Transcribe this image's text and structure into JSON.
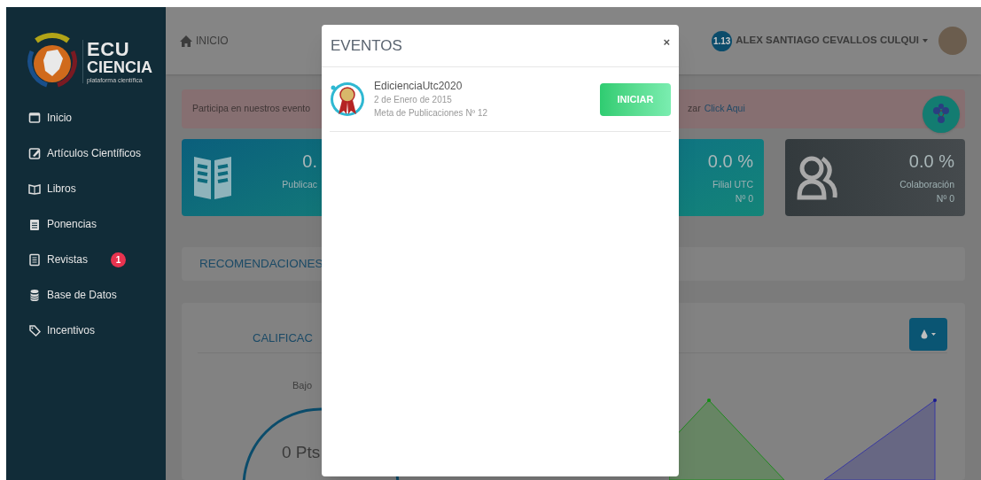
{
  "sidebar": {
    "logo": {
      "line_1": "ECU",
      "line_2": "CIENCIA",
      "tagline": "plataforma científica"
    },
    "items": [
      {
        "label": "Inicio",
        "kind": "square"
      },
      {
        "label": "Artículos Científicos",
        "kind": "edit"
      },
      {
        "label": "Libros",
        "kind": "book"
      },
      {
        "label": "Ponencias",
        "kind": "notepad"
      },
      {
        "label": "Revistas",
        "kind": "document",
        "badge": "1"
      },
      {
        "label": "Base de Datos",
        "kind": "database"
      },
      {
        "label": "Incentivos",
        "kind": "tag"
      }
    ]
  },
  "topbar": {
    "breadcrumb": "INICIO",
    "level_badge": "1.13",
    "user_name": "ALEX SANTIAGO CEVALLOS CULQUI"
  },
  "alert": {
    "text_start": "Participa en nuestros evento",
    "text_end": "zar",
    "link": "Click Aqui"
  },
  "stat_cards": [
    {
      "kind": "book",
      "value": "0.",
      "label": "Publicac"
    },
    {
      "kind": "hidden"
    },
    {
      "kind": "plain",
      "value": "0.0 %",
      "label": "Filial UTC",
      "count": "Nº 0"
    },
    {
      "kind": "people",
      "value": "0.0 %",
      "label": "Colaboración",
      "count": "Nº 0"
    }
  ],
  "recommendations": {
    "title": "RECOMENDACIONES"
  },
  "rating": {
    "title": "CALIFICAC",
    "level_label": "Bajo",
    "points": "0 Pts"
  },
  "modal": {
    "title": "EVENTOS",
    "close": "×",
    "events": [
      {
        "name": "EdicienciaUtc2020",
        "date": "2 de Enero de 2015",
        "goal": "Meta de Publicaciones Nº 12",
        "action": "INICIAR"
      }
    ]
  }
}
